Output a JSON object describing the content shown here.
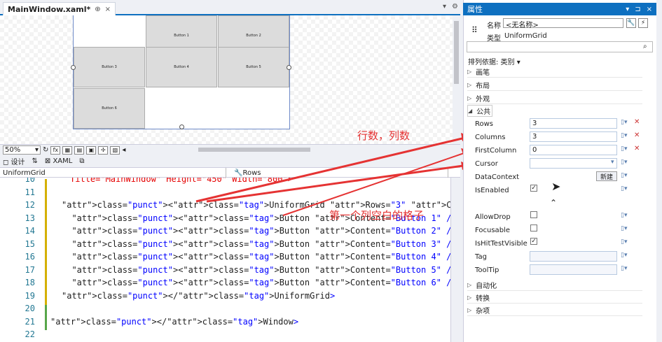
{
  "editor": {
    "tab_title": "MainWindow.xaml*",
    "tab_pin": "⊕",
    "tab_close": "×",
    "tab_dropdown": "▾",
    "tab_gear": "⚙"
  },
  "designer": {
    "buttons": [
      "Button 1",
      "Button 2",
      "Button 3",
      "Button 4",
      "Button 5",
      "Button 6"
    ],
    "zoom": "50%",
    "fx_label": "fx"
  },
  "split": {
    "design_tab": "设计",
    "swap": "⇅",
    "xaml_tab": "XAML"
  },
  "navbar": {
    "left": "UniformGrid",
    "right": "Rows"
  },
  "code": {
    "lines": [
      {
        "num": "10",
        "text": "Title=\"MainWindow\" Height=\"450\" Width=\"800\">"
      },
      {
        "num": "11",
        "text": ""
      },
      {
        "num": "12",
        "text": "<UniformGrid Rows=\"3\" Columns=\"3\" FirstColumn=\"1\">"
      },
      {
        "num": "13",
        "text": "  <Button Content=\"Button 1\" />"
      },
      {
        "num": "14",
        "text": "  <Button Content=\"Button 2\" />"
      },
      {
        "num": "15",
        "text": "  <Button Content=\"Button 3\" />"
      },
      {
        "num": "16",
        "text": "  <Button Content=\"Button 4\" />"
      },
      {
        "num": "17",
        "text": "  <Button Content=\"Button 5\" />"
      },
      {
        "num": "18",
        "text": "  <Button Content=\"Button 6\" />"
      },
      {
        "num": "19",
        "text": "</UniformGrid>"
      },
      {
        "num": "20",
        "text": ""
      },
      {
        "num": "21",
        "text": "</Window>"
      },
      {
        "num": "22",
        "text": ""
      }
    ]
  },
  "annotations": {
    "rows_cols": "行数，列数",
    "first_col": "第一个列空白的格子"
  },
  "properties": {
    "header": "属性",
    "header_icons": [
      "▾",
      "⊐",
      "×"
    ],
    "name_label": "名称",
    "name_value": "<无名称>",
    "type_label": "类型",
    "type_value": "UniformGrid",
    "sort_label": "排列依据: 类别 ▾",
    "categories_top": [
      "画笔",
      "布局",
      "外观"
    ],
    "common": "公共",
    "rows": [
      {
        "name": "Rows",
        "value": "3"
      },
      {
        "name": "Columns",
        "value": "3"
      },
      {
        "name": "FirstColumn",
        "value": "0"
      },
      {
        "name": "Cursor",
        "value": ""
      },
      {
        "name": "DataContext",
        "value": ""
      },
      {
        "name": "IsEnabled",
        "value": "✓"
      }
    ],
    "new_button": "新建",
    "advanced": [
      {
        "name": "AllowDrop",
        "value": ""
      },
      {
        "name": "Focusable",
        "value": ""
      },
      {
        "name": "IsHitTestVisible",
        "value": "✓"
      },
      {
        "name": "Tag",
        "value": ""
      },
      {
        "name": "ToolTip",
        "value": ""
      }
    ],
    "categories_bottom": [
      "自动化",
      "转换",
      "杂项"
    ]
  }
}
